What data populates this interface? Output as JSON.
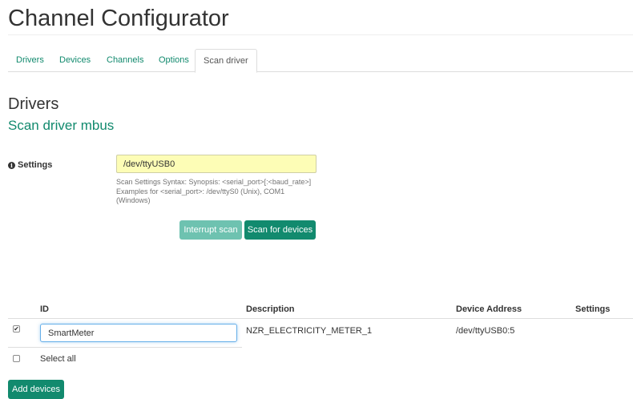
{
  "app": {
    "title": "Channel Configurator"
  },
  "tabs": [
    {
      "label": "Drivers",
      "active": false
    },
    {
      "label": "Devices",
      "active": false
    },
    {
      "label": "Channels",
      "active": false
    },
    {
      "label": "Options",
      "active": false
    },
    {
      "label": "Scan driver",
      "active": true
    }
  ],
  "section": {
    "title": "Drivers",
    "subtitle": "Scan driver mbus"
  },
  "settings": {
    "label": "Settings",
    "value": "/dev/ttyUSB0",
    "help": [
      "Scan Settings Syntax: Synopsis: <serial_port>[:<baud_rate>]",
      "Examples for <serial_port>: /dev/ttyS0 (Unix), COM1",
      "(Windows)"
    ]
  },
  "buttons": {
    "interrupt_scan": "Interrupt scan",
    "scan_for_devices": "Scan for devices",
    "add_devices": "Add devices"
  },
  "table": {
    "headers": {
      "id": "ID",
      "description": "Description",
      "device_address": "Device Address",
      "settings": "Settings"
    },
    "rows": [
      {
        "checked": true,
        "id": "SmartMeter",
        "description": "NZR_ELECTRICITY_METER_1",
        "device_address": "/dev/ttyUSB0:5",
        "settings": ""
      }
    ],
    "select_all": {
      "label": "Select all",
      "checked": false
    }
  },
  "colors": {
    "accent": "#128a6e",
    "accent_light": "#6ec2b0",
    "input_highlight": "#fdfdb6"
  },
  "icons": {
    "settings_info": "info-circle-icon",
    "row_checkbox": "checkbox-checked-icon",
    "select_all_checkbox": "checkbox-unchecked-icon"
  }
}
